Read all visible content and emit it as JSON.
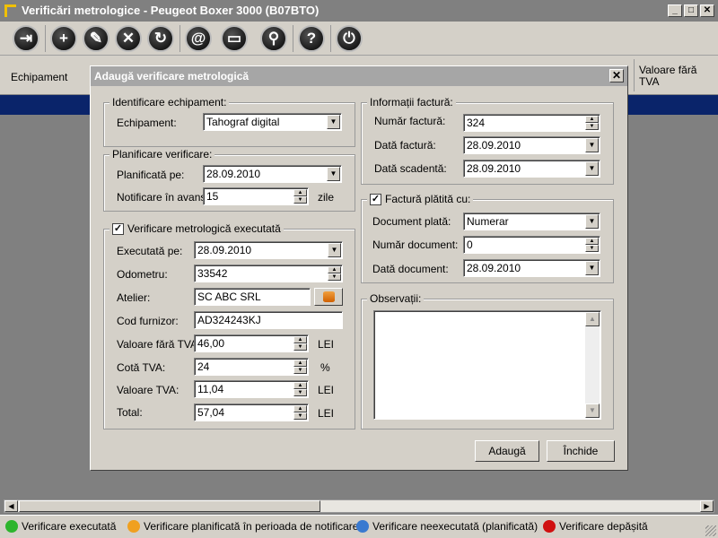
{
  "window": {
    "title": "Verificări metrologice - Peugeot Boxer 3000 (B07BTO)",
    "min": "_",
    "max": "□",
    "close": "✕"
  },
  "toolbar": {
    "buttons": [
      {
        "icon": "exit-icon",
        "glyph": "⇥"
      },
      {
        "icon": "add-icon",
        "glyph": "+"
      },
      {
        "icon": "edit-icon",
        "glyph": "✎"
      },
      {
        "icon": "delete-icon",
        "glyph": "✕"
      },
      {
        "icon": "refresh-icon",
        "glyph": "↻"
      },
      {
        "icon": "email-icon",
        "glyph": "@"
      },
      {
        "icon": "print-icon",
        "glyph": "▭"
      },
      {
        "icon": "search-icon",
        "glyph": "⚲"
      },
      {
        "icon": "help-icon",
        "glyph": "?"
      },
      {
        "icon": "power-icon",
        "glyph": "⏻"
      }
    ]
  },
  "grid": {
    "col_equipment": "Echipament",
    "col_value_no_vat": "Valoare fără TVA"
  },
  "status_legend": [
    {
      "label": "Verificare executată",
      "color": "#2db52d"
    },
    {
      "label": "Verificare planificată în perioada de notificare",
      "color": "#f0a020"
    },
    {
      "label": "Verificare neexecutată (planificată)",
      "color": "#3a7ad0"
    },
    {
      "label": "Verificare depășită",
      "color": "#d01010"
    }
  ],
  "dialog": {
    "title": "Adaugă verificare metrologică",
    "close": "✕",
    "id_group": {
      "title": "Identificare echipament:",
      "equipment_label": "Echipament:",
      "equipment_value": "Tahograf digital"
    },
    "plan_group": {
      "title": "Planificare verificare:",
      "planned_label": "Planificată pe:",
      "planned_value": "28.09.2010",
      "notify_label": "Notificare în avans:",
      "notify_value": "15",
      "notify_unit": "zile"
    },
    "exec_group": {
      "title": "Verificare metrologică executată",
      "checked": "✓",
      "executed_label": "Executată pe:",
      "executed_value": "28.09.2010",
      "odometer_label": "Odometru:",
      "odometer_value": "33542",
      "workshop_label": "Atelier:",
      "workshop_value": "SC ABC SRL",
      "supplier_label": "Cod furnizor:",
      "supplier_value": "AD324243KJ",
      "value_label": "Valoare fără TVA:",
      "value_value": "46,00",
      "value_unit": "LEI",
      "vat_rate_label": "Cotă TVA:",
      "vat_rate_value": "24",
      "vat_rate_unit": "%",
      "vat_label": "Valoare TVA:",
      "vat_value": "11,04",
      "vat_unit": "LEI",
      "total_label": "Total:",
      "total_value": "57,04",
      "total_unit": "LEI"
    },
    "invoice_group": {
      "title": "Informații factură:",
      "number_label": "Număr factură:",
      "number_value": "324",
      "date_label": "Dată factură:",
      "date_value": "28.09.2010",
      "due_label": "Dată scadentă:",
      "due_value": "28.09.2010"
    },
    "paid_group": {
      "title": "Factură plătită cu:",
      "checked": "✓",
      "doc_label": "Document plată:",
      "doc_value": "Numerar",
      "docnum_label": "Număr document:",
      "docnum_value": "0",
      "docdate_label": "Dată document:",
      "docdate_value": "28.09.2010"
    },
    "notes_group": {
      "title": "Observații:"
    },
    "add_button": "Adaugă",
    "close_button": "Închide"
  }
}
